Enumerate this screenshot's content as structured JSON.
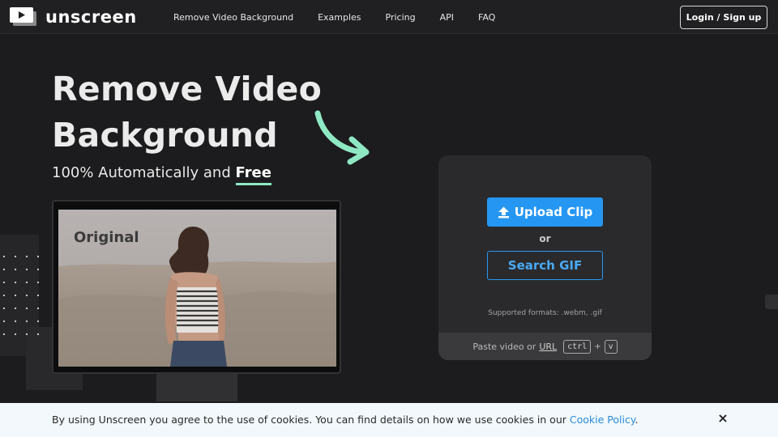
{
  "nav": {
    "brand": "unscreen",
    "links": [
      "Remove Video Background",
      "Examples",
      "Pricing",
      "API",
      "FAQ"
    ],
    "login_label": "Login / Sign up"
  },
  "hero": {
    "title_line1": "Remove Video",
    "title_line2": "Background",
    "subtitle_prefix": "100% Automatically and ",
    "subtitle_free": "Free",
    "demo_label": "Original"
  },
  "upload": {
    "upload_label": "Upload Clip",
    "or_label": "or",
    "search_label": "Search GIF",
    "formats_text": "Supported formats: .webm, .gif",
    "paste_prefix": "Paste video or",
    "paste_url": "URL",
    "key_ctrl": "ctrl",
    "key_plus": "+",
    "key_v": "v"
  },
  "cookie": {
    "text": "By using Unscreen you agree to the use of cookies. You can find details on how we use cookies in our ",
    "link": "Cookie Policy",
    "suffix": ".",
    "close": "×"
  },
  "colors": {
    "accent_blue": "#2596f2",
    "accent_green": "#8ee8c4",
    "background": "#1c1c1e"
  },
  "icons": [
    "play-logo-icon",
    "upload-icon",
    "curved-arrow-icon",
    "close-icon"
  ]
}
